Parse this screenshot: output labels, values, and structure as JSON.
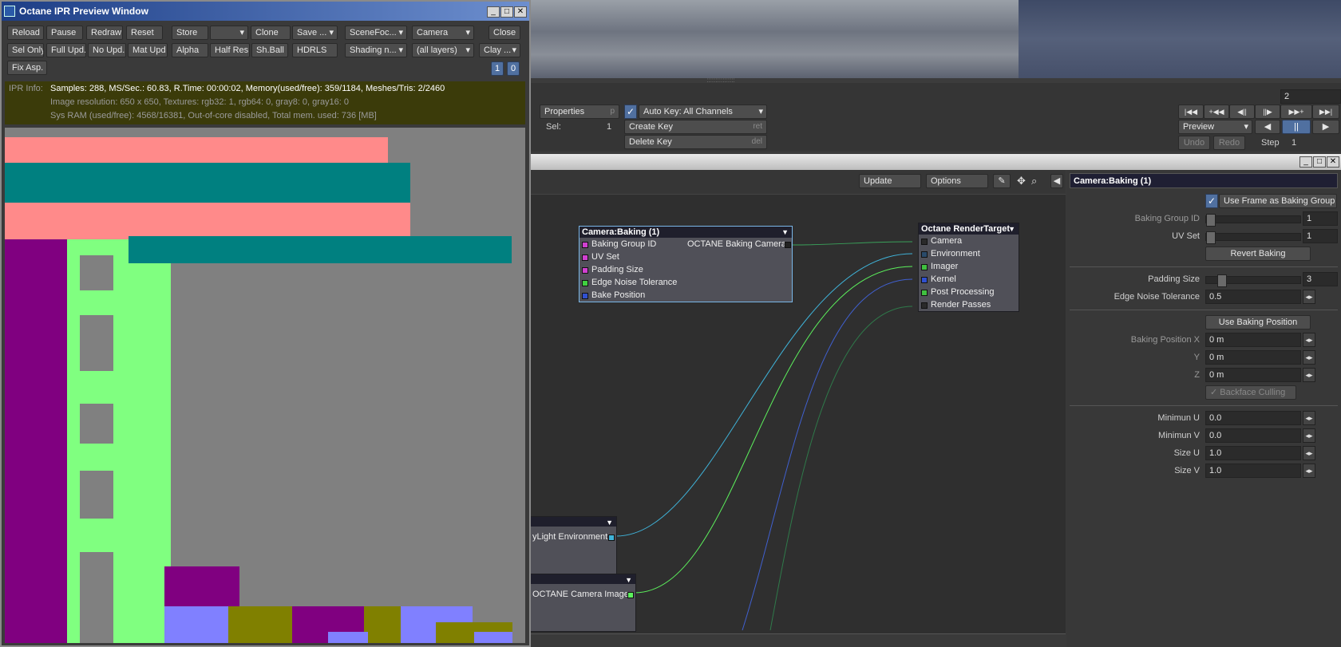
{
  "ipr": {
    "title": "Octane IPR Preview Window",
    "buttons_row1": [
      "Reload",
      "Pause",
      "Redraw",
      "Reset"
    ],
    "store": "Store",
    "clone": "Clone",
    "save": "Save ...",
    "scene_focus": "SceneFoc...",
    "camera": "Camera",
    "close": "Close",
    "buttons_row2": [
      "Sel Only",
      "Full Upd.",
      "No Upd.",
      "Mat Upd",
      "Alpha",
      "Half Res",
      "Sh.Ball",
      "HDRLS"
    ],
    "shading": "Shading n...",
    "layers": "(all layers)",
    "clay": "Clay ...",
    "fix_asp": "Fix Asp.",
    "num1": "1",
    "num2": "0",
    "info_label": "IPR Info:",
    "info_line1": "Samples: 288, MS/Sec.: 60.83, R.Time: 00:00:02, Memory(used/free): 359/1184, Meshes/Tris: 2/2460",
    "info_line2": "Image resolution: 650 x 650, Textures:  rgb32: 1, rgb64: 0, gray8: 0, gray16: 0",
    "info_line3": "Sys RAM (used/free): 4568/16381, Out-of-core disabled, Total mem. used: 736  [MB]"
  },
  "toolbar": {
    "frame": "2",
    "properties": "Properties",
    "properties_key": "p",
    "sel_label": "Sel:",
    "sel_value": "1",
    "auto_key": "Auto Key: All Channels",
    "create_key": "Create Key",
    "create_key_hint": "ret",
    "delete_key": "Delete Key",
    "delete_key_hint": "del",
    "preview": "Preview",
    "undo": "Undo",
    "redo": "Redo",
    "step_label": "Step",
    "step_value": "1",
    "transport": [
      "|◀◀",
      "+◀◀",
      "◀||",
      "||▶",
      "▶▶+",
      "▶▶|"
    ],
    "play_back": "◀",
    "pause": "||",
    "play": "▶"
  },
  "node_editor": {
    "update": "Update",
    "options": "Options",
    "camera_node": {
      "title": "Camera:Baking (1)",
      "ports": [
        "Baking Group ID",
        "UV Set",
        "Padding Size",
        "Edge Noise Tolerance",
        "Bake Position"
      ],
      "output": "OCTANE Baking Camera"
    },
    "render_target": {
      "title": "Octane RenderTarget",
      "ports": [
        "Camera",
        "Environment",
        "Imager",
        "Kernel",
        "Post Processing",
        "Render Passes"
      ]
    },
    "env_node_output": "yLight Environment",
    "imager_node_output": "OCTANE Camera Imager"
  },
  "panel": {
    "title": "Camera:Baking (1)",
    "use_frame": "Use Frame as Baking Group",
    "baking_group_id_label": "Baking Group ID",
    "baking_group_id": "1",
    "uv_set_label": "UV Set",
    "uv_set": "1",
    "revert": "Revert Baking",
    "padding_label": "Padding Size",
    "padding": "3",
    "edge_label": "Edge Noise Tolerance",
    "edge": "0.5",
    "use_baking_pos": "Use Baking Position",
    "pos_x_label": "Baking Position X",
    "pos_x": "0 m",
    "pos_y_label": "Y",
    "pos_y": "0 m",
    "pos_z_label": "Z",
    "pos_z": "0 m",
    "backface": "Backface Culling",
    "min_u_label": "Minimun U",
    "min_u": "0.0",
    "min_v_label": "Minimun V",
    "min_v": "0.0",
    "size_u_label": "Size U",
    "size_u": "1.0",
    "size_v_label": "Size V",
    "size_v": "1.0"
  }
}
